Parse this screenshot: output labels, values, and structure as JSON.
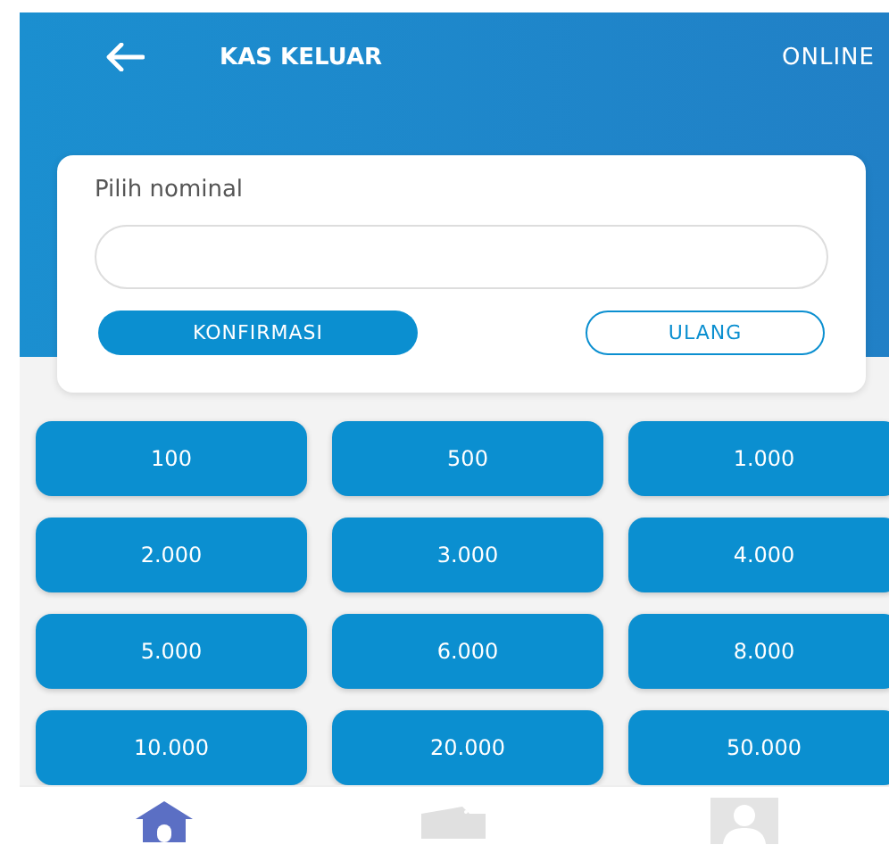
{
  "header": {
    "title": "KAS KELUAR",
    "status": "ONLINE"
  },
  "form": {
    "label": "Pilih nominal",
    "confirm_button": "KONFIRMASI",
    "reset_button": "ULANG"
  },
  "amounts": [
    "100",
    "500",
    "1.000",
    "2.000",
    "3.000",
    "4.000",
    "5.000",
    "6.000",
    "8.000",
    "10.000",
    "20.000",
    "50.000"
  ],
  "bottom_nav": [
    {
      "kind": "home",
      "selected": true
    },
    {
      "kind": "wallet",
      "selected": false
    },
    {
      "kind": "profile",
      "selected": false
    }
  ]
}
